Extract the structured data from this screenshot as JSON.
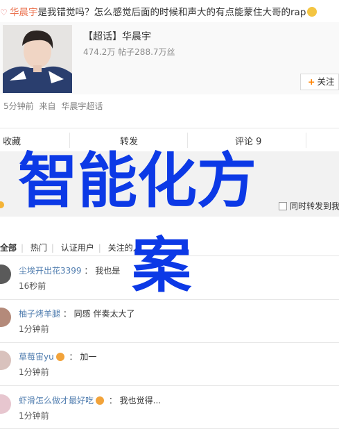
{
  "post": {
    "title_name": "华晨宇",
    "title_text": "是我错觉吗？怎么感觉后面的时候和声大的有点能蒙住大哥的rap"
  },
  "card": {
    "title": "【超话】华晨宇",
    "meta": "474.2万  帖子288.7万丝",
    "follow_label": "关注"
  },
  "meta_line": {
    "time": "5分钟前",
    "from_prefix": "来自",
    "source": "华晨宇超话"
  },
  "actions": {
    "collect": "收藏",
    "repost": "转发",
    "comment": "评论 9"
  },
  "compose": {
    "repost_checkbox_label": "同时转发到我"
  },
  "filters": {
    "all": "全部",
    "hot": "热门",
    "verified": "认证用户",
    "following": "关注的人"
  },
  "comments": [
    {
      "name": "尘埃开出花3399",
      "text": "我也是",
      "time": "16秒前",
      "badge": ""
    },
    {
      "name": "柚子烤羊腿",
      "text": "同感 伴奏太大了",
      "time": "1分钟前",
      "badge": ""
    },
    {
      "name": "草莓宙yu",
      "text": "加一",
      "time": "1分钟前",
      "badge": "crown-icon"
    },
    {
      "name": "虾滑怎么做才最好吃",
      "text": "我也觉得...",
      "time": "1分钟前",
      "badge": "crown-icon"
    }
  ],
  "overlay": {
    "line1": "智能化方",
    "line2": "案"
  },
  "colors": {
    "name_orange": "#eb7350",
    "link_blue": "#507daf",
    "overlay_blue": "#0c39e6",
    "follow_plus": "#ff8200"
  }
}
